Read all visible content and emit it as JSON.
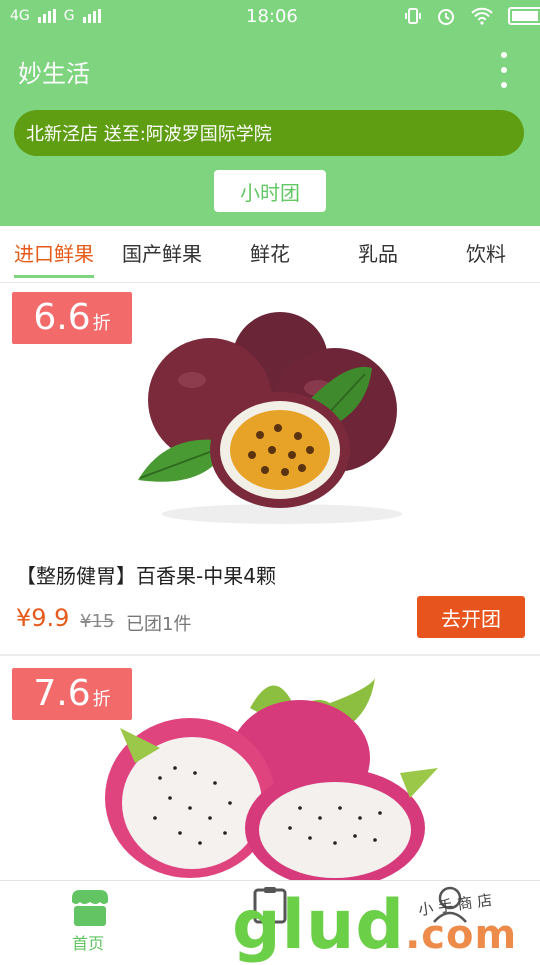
{
  "status_bar": {
    "net1": "4G",
    "net2": "G",
    "time": "18:06"
  },
  "header": {
    "title": "妙生活",
    "address": "北新泾店 送至:阿波罗国际学院",
    "group_button": "小时团"
  },
  "tabs": [
    "进口鲜果",
    "国产鲜果",
    "鲜花",
    "乳品",
    "饮料"
  ],
  "active_tab": 0,
  "products": [
    {
      "discount": "6.6",
      "discount_unit": "折",
      "name": "【整肠健胃】百香果-中果4颗",
      "price": "¥9.9",
      "original_price": "¥15",
      "sold": "已团1件",
      "button": "去开团"
    },
    {
      "discount": "7.6",
      "discount_unit": "折"
    }
  ],
  "bottom_nav": {
    "home_label": "首页"
  },
  "watermark": {
    "brand": "glud",
    "suffix": ".com",
    "small": "小 手 商 店"
  },
  "colors": {
    "header_green": "#7ed47f",
    "address_green": "#5f9e13",
    "accent_orange": "#e8541e",
    "discount_red": "#f26a6a"
  }
}
